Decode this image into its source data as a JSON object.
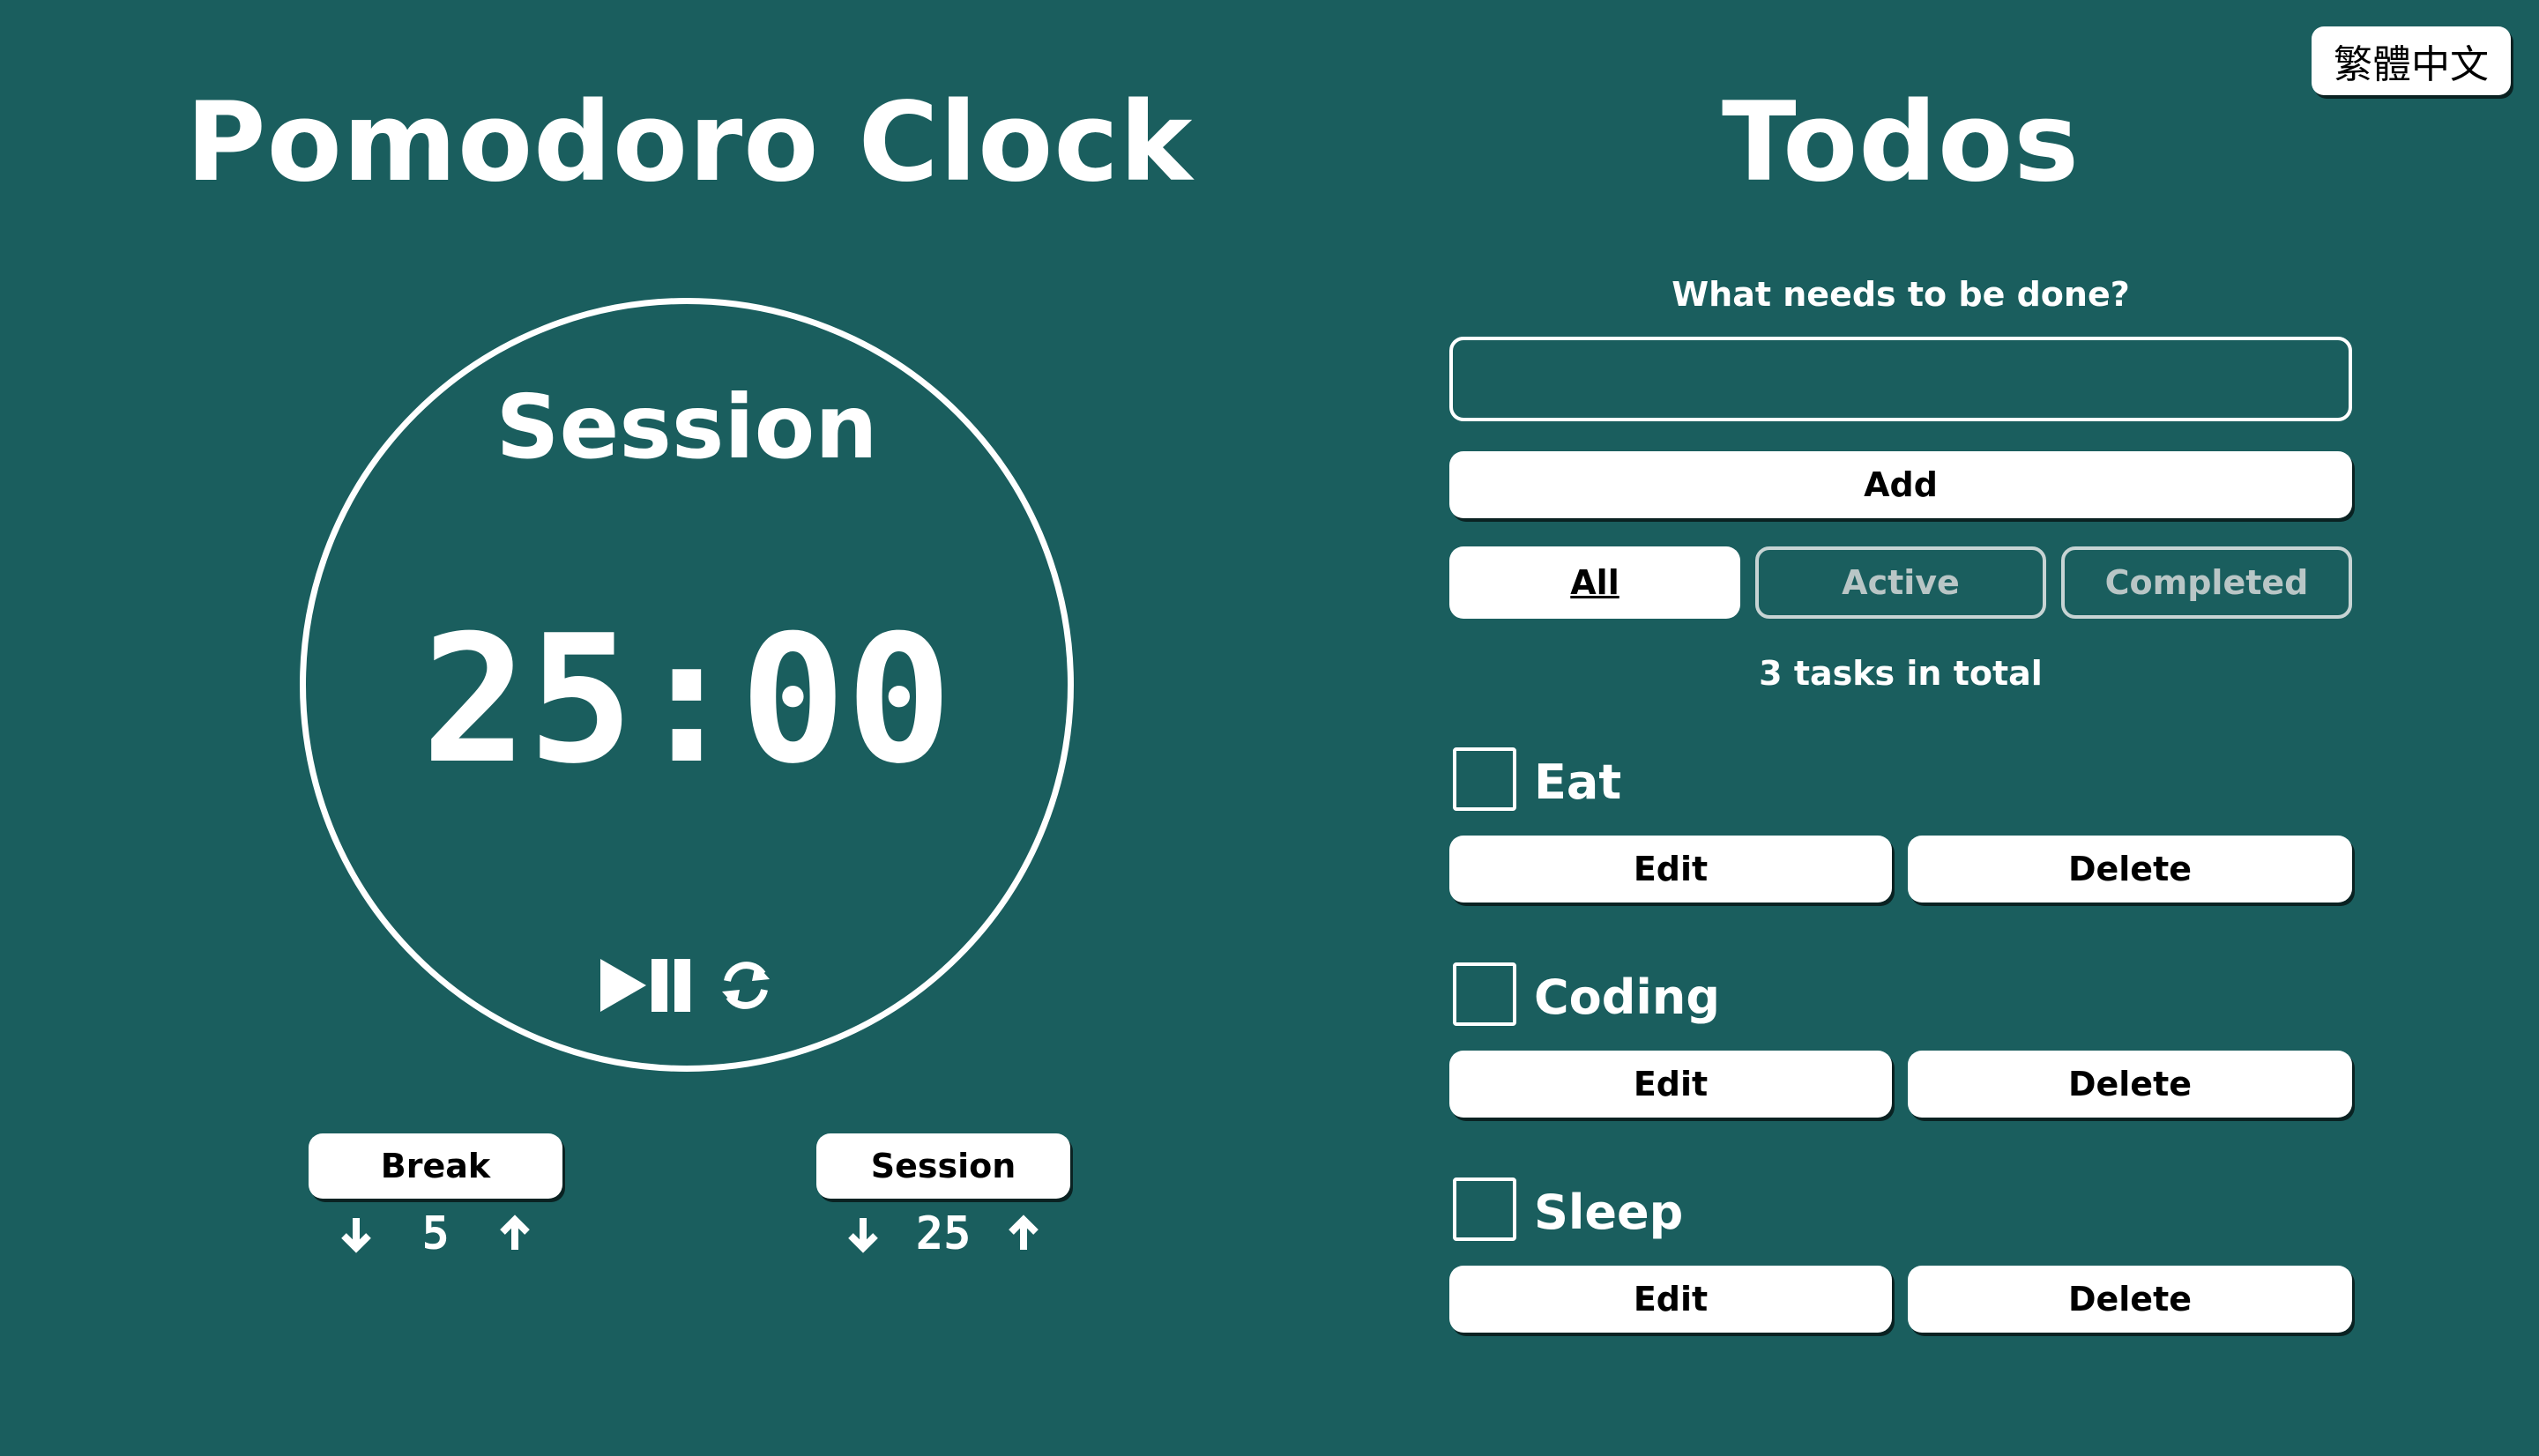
{
  "lang_button": "繁體中文",
  "pomodoro": {
    "title": "Pomodoro Clock",
    "mode_label": "Session",
    "time": "25:00",
    "break": {
      "label": "Break",
      "value": "5"
    },
    "session": {
      "label": "Session",
      "value": "25"
    }
  },
  "todos": {
    "title": "Todos",
    "prompt": "What needs to be done?",
    "input_value": "",
    "add_label": "Add",
    "filters": [
      "All",
      "Active",
      "Completed"
    ],
    "selected_filter": "All",
    "count_text": "3 tasks in total",
    "edit_label": "Edit",
    "delete_label": "Delete",
    "items": [
      {
        "label": "Eat",
        "done": false
      },
      {
        "label": "Coding",
        "done": false
      },
      {
        "label": "Sleep",
        "done": false
      }
    ]
  }
}
